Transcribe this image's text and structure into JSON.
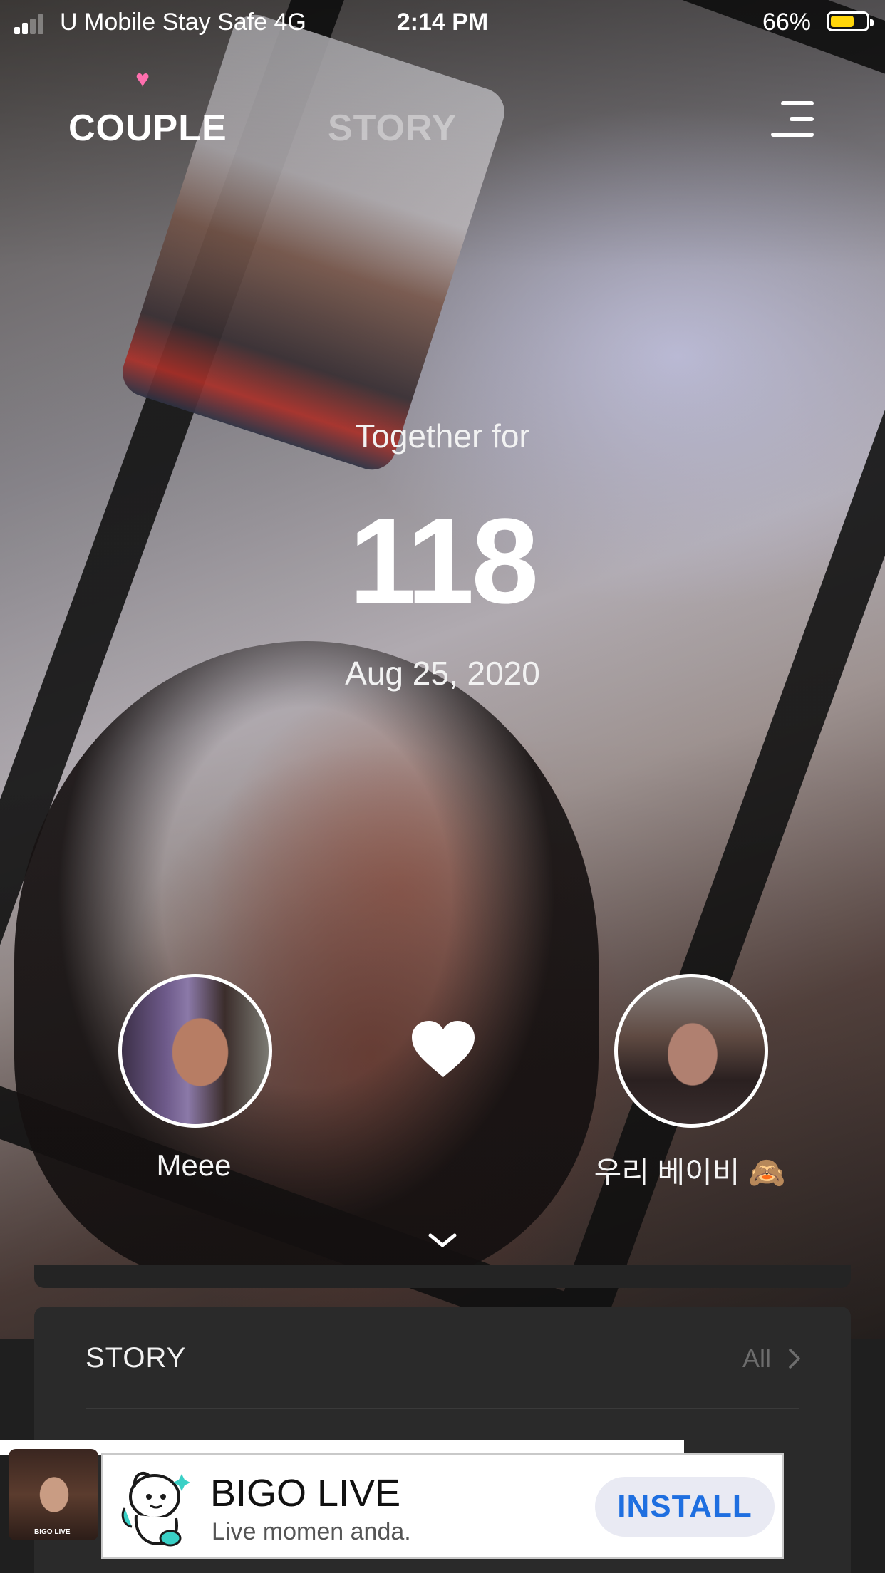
{
  "status_bar": {
    "carrier": "U Mobile Stay Safe  4G",
    "time": "2:14 PM",
    "battery_percent": "66%",
    "battery_level": 0.66,
    "battery_color": "#ffd60a"
  },
  "nav": {
    "tabs": [
      {
        "label": "COUPLE",
        "active": true
      },
      {
        "label": "STORY",
        "active": false
      }
    ],
    "active_indicator_icon": "heart-icon",
    "active_indicator_color": "#ff6fae",
    "menu_icon": "menu-icon"
  },
  "counter": {
    "label": "Together for",
    "days": "118",
    "start_date": "Aug 25, 2020"
  },
  "couple": {
    "left": {
      "name": "Meee"
    },
    "right": {
      "name": "우리 베이비 🙈"
    },
    "center_icon": "heart-icon",
    "expand_icon": "chevron-down-icon"
  },
  "story_section": {
    "title": "STORY",
    "all_link": "All"
  },
  "ad": {
    "thumb_mark": "BIGO LIVE",
    "title": "BIGO LIVE",
    "subtitle": "Live momen anda.",
    "cta": "INSTALL",
    "cta_color": "#1f6fe0"
  }
}
